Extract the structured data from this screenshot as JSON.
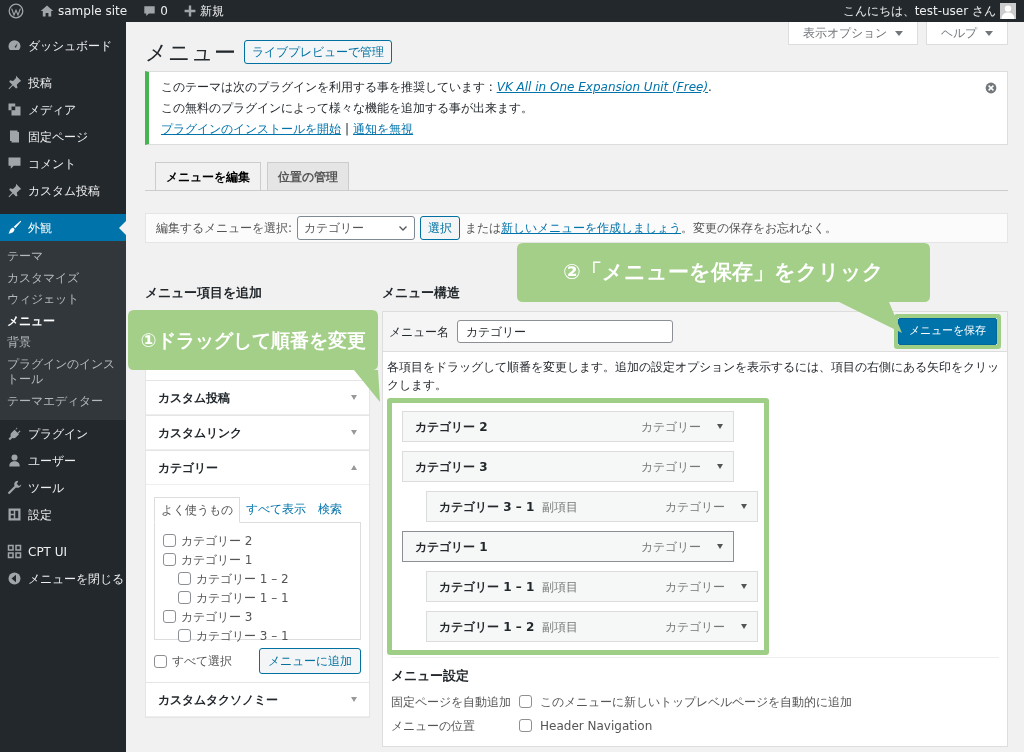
{
  "admin_bar": {
    "site": "sample site",
    "comments": "0",
    "new": "新規",
    "greeting": "こんにちは、test-user さん"
  },
  "sidebar": {
    "sections": [
      {
        "items": [
          {
            "label": "ダッシュボード",
            "selected": false
          }
        ]
      },
      {
        "items": [
          {
            "label": "投稿",
            "selected": false
          },
          {
            "label": "メディア",
            "selected": false
          },
          {
            "label": "固定ページ",
            "selected": false
          },
          {
            "label": "コメント",
            "selected": false
          },
          {
            "label": "カスタム投稿",
            "selected": false
          }
        ]
      },
      {
        "items": [
          {
            "label": "外観",
            "selected": true,
            "children": [
              {
                "label": "テーマ",
                "selected": false
              },
              {
                "label": "カスタマイズ",
                "selected": false
              },
              {
                "label": "ウィジェット",
                "selected": false
              },
              {
                "label": "メニュー",
                "selected": true
              },
              {
                "label": "背景",
                "selected": false
              },
              {
                "label": "プラグインのインストール",
                "selected": false
              },
              {
                "label": "テーマエディター",
                "selected": false
              }
            ]
          },
          {
            "label": "プラグイン",
            "selected": false
          },
          {
            "label": "ユーザー",
            "selected": false
          },
          {
            "label": "ツール",
            "selected": false
          },
          {
            "label": "設定",
            "selected": false
          }
        ]
      },
      {
        "items": [
          {
            "label": "CPT UI",
            "selected": false
          },
          {
            "label": "メニューを閉じる",
            "selected": false
          }
        ]
      }
    ]
  },
  "screen_tabs": [
    "表示オプション",
    "ヘルプ"
  ],
  "page": {
    "title": "メニュー",
    "action": "ライブプレビューで管理"
  },
  "notice": {
    "text": "このテーマは次のプラグインを利用する事を推奨しています : ",
    "link": "VK All in One Expansion Unit (Free)",
    "suffix": ".",
    "line2": "この無料のプラグインによって様々な機能を追加する事が出来ます。",
    "actions": [
      "プラグインのインストールを開始",
      "通知を無視"
    ],
    "separator": "|"
  },
  "tabs": [
    {
      "label": "メニューを編集",
      "selected": true
    },
    {
      "label": "位置の管理",
      "selected": false
    }
  ],
  "select_bar": {
    "label": "編集するメニューを選択:",
    "value": "カテゴリー",
    "button": "選択",
    "text": "または",
    "link": "新しいメニューを作成しましょう",
    "tail": "。変更の保存をお忘れなく。"
  },
  "add_items": {
    "heading": "メニュー項目を追加",
    "panels": [
      {
        "title": "カスタム投稿",
        "expanded": false
      },
      {
        "title": "カスタムリンク",
        "expanded": false
      },
      {
        "title": "カテゴリー",
        "expanded": true,
        "tabs": [
          {
            "label": "よく使うもの",
            "selected": true
          },
          {
            "label": "すべて表示",
            "selected": false
          },
          {
            "label": "検索",
            "selected": false
          }
        ],
        "items": [
          {
            "label": "カテゴリー 2",
            "checked": false
          },
          {
            "label": "カテゴリー 1",
            "checked": false,
            "children": [
              {
                "label": "カテゴリー 1 – 2",
                "checked": false
              },
              {
                "label": "カテゴリー 1 – 1",
                "checked": false
              }
            ]
          },
          {
            "label": "カテゴリー 3",
            "checked": false,
            "children": [
              {
                "label": "カテゴリー 3 – 1",
                "checked": false
              }
            ]
          }
        ],
        "select_all": {
          "label": "すべて選択",
          "checked": false
        },
        "button": "メニューに追加"
      },
      {
        "title": "カスタムタクソノミー",
        "expanded": false
      }
    ]
  },
  "structure": {
    "heading": "メニュー構造",
    "name_label": "メニュー名",
    "name_value": "カテゴリー",
    "save": "メニューを保存",
    "hint": "各項目をドラッグして順番を変更します。追加の設定オプションを表示するには、項目の右側にある矢印をクリックします。",
    "items": [
      {
        "title": "カテゴリー 2",
        "type": "カテゴリー",
        "selected": false
      },
      {
        "title": "カテゴリー 3",
        "type": "カテゴリー",
        "selected": false,
        "children": [
          {
            "title": "カテゴリー 3 – 1",
            "sub": "副項目",
            "type": "カテゴリー",
            "selected": false
          }
        ]
      },
      {
        "title": "カテゴリー 1",
        "type": "カテゴリー",
        "selected": true,
        "children": [
          {
            "title": "カテゴリー 1 – 1",
            "sub": "副項目",
            "type": "カテゴリー",
            "selected": false
          },
          {
            "title": "カテゴリー 1 – 2",
            "sub": "副項目",
            "type": "カテゴリー",
            "selected": false
          }
        ]
      }
    ]
  },
  "settings": {
    "heading": "メニュー設定",
    "rows": [
      {
        "label": "固定ページを自動追加",
        "options": [
          {
            "label": "このメニューに新しいトップレベルページを自動的に追加",
            "checked": false
          }
        ]
      },
      {
        "label": "メニューの位置",
        "options": [
          {
            "label": "Header Navigation",
            "checked": false
          }
        ]
      }
    ]
  },
  "callouts": [
    {
      "text": "①ドラッグして順番を変更"
    },
    {
      "text": "②「メニューを保存」をクリック"
    }
  ]
}
